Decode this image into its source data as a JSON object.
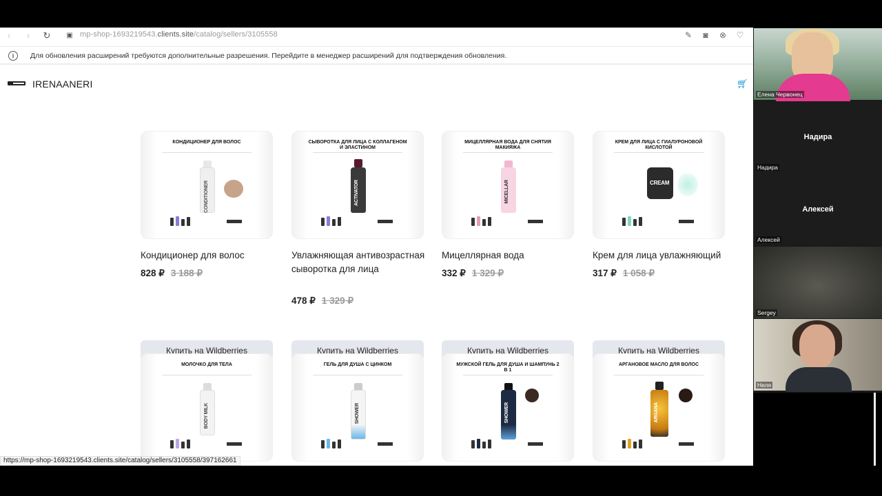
{
  "browser": {
    "url_prefix": "mp-shop-1693219543.",
    "url_host": "clients.site",
    "url_path": "/catalog/sellers/3105558",
    "notice": "Для обновления расширений требуются дополнительные разрешения. Перейдите в менеджер расширений для подтверждения обновления.",
    "status_url": "https://mp-shop-1693219543.clients.site/catalog/sellers/3105558/397162661"
  },
  "site": {
    "brand": "IRENAANERI"
  },
  "products": [
    {
      "title": "Кондиционер для волос",
      "price": "828 ₽",
      "old_price": "3 188 ₽",
      "button": "Купить на Wildberries",
      "image_title": "КОНДИЦИОНЕР ДЛЯ ВОЛОС",
      "bottle_label": "CONDITIONER"
    },
    {
      "title": "Увлажняющая антивозрастная сыворотка для лица",
      "price": "478 ₽",
      "old_price": "1 329 ₽",
      "button": "Купить на Wildberries",
      "image_title": "СЫВОРОТКА ДЛЯ ЛИЦА С КОЛЛАГЕНОМ И ЭЛАСТИНОМ",
      "bottle_label": "ACTIVATOR"
    },
    {
      "title": "Мицеллярная вода",
      "price": "332 ₽",
      "old_price": "1 329 ₽",
      "button": "Купить на Wildberries",
      "image_title": "МИЦЕЛЛЯРНАЯ ВОДА ДЛЯ СНЯТИЯ МАКИЯЖА",
      "bottle_label": "MICELLAR"
    },
    {
      "title": "Крем для лица увлажняющий",
      "price": "317 ₽",
      "old_price": "1 058 ₽",
      "button": "Купить на Wildberries",
      "image_title": "КРЕМ ДЛЯ ЛИЦА С ГИАЛУРОНОВОЙ КИСЛОТОЙ",
      "bottle_label": "CREAM"
    },
    {
      "image_title": "МОЛОЧКО ДЛЯ ТЕЛА",
      "bottle_label": "BODY MILK"
    },
    {
      "image_title": "ГЕЛЬ ДЛЯ ДУША С ЦИНКОМ",
      "bottle_label": "SHOWER"
    },
    {
      "image_title": "МУЖСКОЙ ГЕЛЬ ДЛЯ ДУША И ШАМПУНЬ 2 в 1",
      "bottle_label": "SHOWER"
    },
    {
      "image_title": "АРГАНОВОЕ МАСЛО ДЛЯ ВОЛОС",
      "bottle_label": "ARGANA"
    }
  ],
  "participants": [
    {
      "name": "Елена Червонец"
    },
    {
      "name": "Надира",
      "center_name": "Надира"
    },
    {
      "name": "Алексей",
      "center_name": "Алексей"
    },
    {
      "name": "Sergey"
    },
    {
      "name": "Неля"
    }
  ],
  "colors": {
    "accent": "#0d8fd6",
    "button_bg": "#e5e7ee"
  }
}
